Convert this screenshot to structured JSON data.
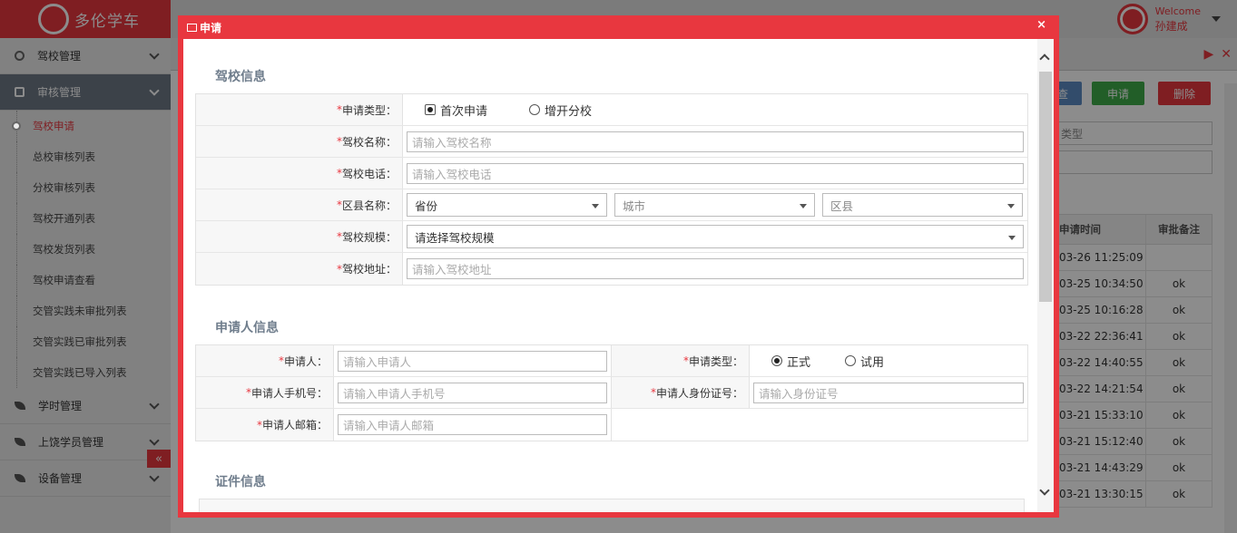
{
  "app": {
    "logo_text": "多伦学车",
    "welcome": "Welcome",
    "user_name": "孙建成"
  },
  "sidebar": {
    "groups": [
      {
        "label": "驾校管理"
      },
      {
        "label": "审核管理"
      },
      {
        "label": "学时管理"
      },
      {
        "label": "上饶学员管理"
      },
      {
        "label": "设备管理"
      }
    ],
    "items": [
      {
        "label": "驾校申请"
      },
      {
        "label": "总校审核列表"
      },
      {
        "label": "分校审核列表"
      },
      {
        "label": "驾校开通列表"
      },
      {
        "label": "驾校发货列表"
      },
      {
        "label": "驾校申请查看"
      },
      {
        "label": "交管实践未审批列表"
      },
      {
        "label": "交管实践已审批列表"
      },
      {
        "label": "交管实践已导入列表"
      }
    ],
    "collapse_glyph": "«"
  },
  "background": {
    "btn_query": "查",
    "btn_apply": "申请",
    "btn_delete": "删除",
    "select_type": "类型",
    "grid_head_time": "申请时间",
    "grid_head_note": "审批备注",
    "rows": [
      {
        "time": "03-26 11:25:09",
        "note": ""
      },
      {
        "time": "03-25 10:34:50",
        "note": "ok"
      },
      {
        "time": "03-25 10:16:28",
        "note": "ok"
      },
      {
        "time": "03-22 22:36:41",
        "note": "ok"
      },
      {
        "time": "03-22 14:40:55",
        "note": "ok"
      },
      {
        "time": "03-22 14:21:54",
        "note": "ok"
      },
      {
        "time": "03-21 15:33:10",
        "note": "ok"
      },
      {
        "time": "03-21 15:12:40",
        "note": "ok"
      },
      {
        "time": "03-21 14:43:29",
        "note": "ok"
      },
      {
        "time": "03-21 13:30:15",
        "note": "ok"
      }
    ]
  },
  "dialog": {
    "title": "申请",
    "close": "×",
    "sections": {
      "school": "驾校信息",
      "applicant": "申请人信息",
      "cert": "证件信息"
    },
    "school": {
      "apply_type_label": "申请类型：",
      "apply_type_options": [
        "首次申请",
        "增开分校"
      ],
      "name_label": "驾校名称：",
      "name_placeholder": "请输入驾校名称",
      "phone_label": "驾校电话：",
      "phone_placeholder": "请输入驾校电话",
      "district_label": "区县名称：",
      "province": "省份",
      "city": "城市",
      "county": "区县",
      "scale_label": "驾校规模：",
      "scale_value": "请选择驾校规模",
      "address_label": "驾校地址：",
      "address_placeholder": "请输入驾校地址"
    },
    "applicant": {
      "name_label": "申请人：",
      "name_placeholder": "请输入申请人",
      "type_label": "申请类型：",
      "type_options": [
        "正式",
        "试用"
      ],
      "mobile_label": "申请人手机号：",
      "mobile_placeholder": "请输入申请人手机号",
      "id_label": "申请人身份证号：",
      "id_placeholder": "请输入身份证号",
      "email_label": "申请人邮箱：",
      "email_placeholder": "请输入申请人邮箱"
    },
    "required_mark": "*"
  }
}
